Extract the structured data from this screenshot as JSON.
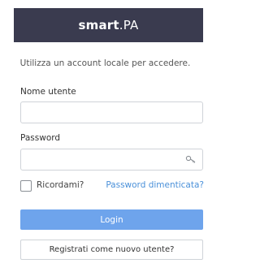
{
  "header": {
    "brand_bold": "smart",
    "brand_light": ".PA",
    "background": "#3a3b4f"
  },
  "subtitle": "Utilizza un account locale per accedere.",
  "form": {
    "username_label": "Nome utente",
    "username_value": "",
    "password_label": "Password",
    "password_value": "",
    "password_icon": "key-icon",
    "remember_label": "Ricordami?",
    "remember_checked": false,
    "forgot_label": "Password dimenticata?",
    "login_label": "Login",
    "register_label": "Registrati come nuovo utente?"
  },
  "colors": {
    "accent": "#6ea4ec",
    "link": "#4a90d9"
  }
}
